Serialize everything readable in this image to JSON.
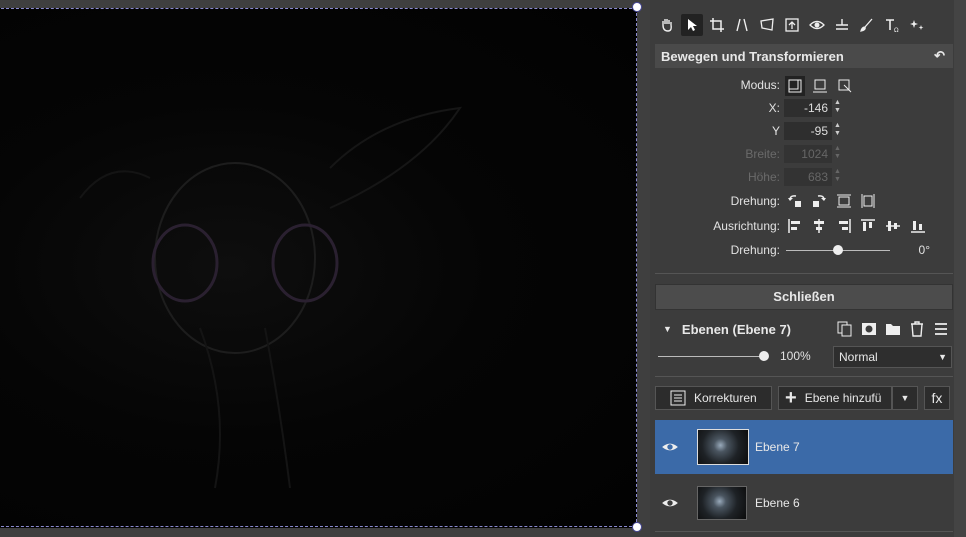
{
  "canvas": {
    "description_hidden": ""
  },
  "panel": {
    "section_title": "Bewegen und Transformieren",
    "modus_label": "Modus:",
    "x_label": "X:",
    "x_value": "-146",
    "y_label": "Y",
    "y_value": "-95",
    "breite_label": "Breite:",
    "breite_value": "1024",
    "hoehe_label": "Höhe:",
    "hoehe_value": "683",
    "drehung_label": "Drehung:",
    "ausrichtung_label": "Ausrichtung:",
    "drehung2_label": "Drehung:",
    "rotation_value": "0°",
    "rotation_fraction": 0.5,
    "close_label": "Schließen"
  },
  "layers": {
    "title": "Ebenen (Ebene 7)",
    "opacity": "100%",
    "opacity_fraction": 1.0,
    "blend_mode": "Normal",
    "korrekturen_label": "Korrekturen",
    "add_layer_label": "Ebene hinzufü",
    "fx_label": "fx",
    "items": [
      {
        "name": "Ebene 7",
        "selected": true
      },
      {
        "name": "Ebene 6",
        "selected": false
      }
    ]
  },
  "colors": {
    "selection": "#3b6aa8",
    "panel_bg": "#3c3c3c",
    "frame": "#8a8acf"
  }
}
